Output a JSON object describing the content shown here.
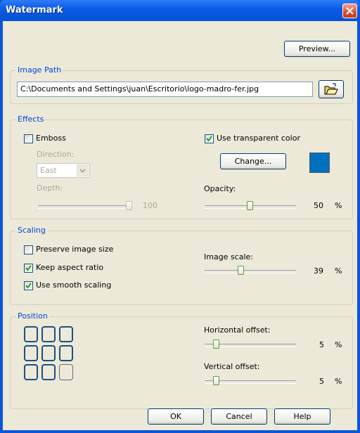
{
  "window": {
    "title": "Watermark"
  },
  "preview_button": "Preview...",
  "image_path": {
    "group_label": "Image Path",
    "path_value": "C:\\Documents and Settings\\juan\\Escritorio\\logo-madro-fer.jpg"
  },
  "effects": {
    "group_label": "Effects",
    "emboss_label": "Emboss",
    "direction_label": "Direction:",
    "direction_value": "East",
    "depth_label": "Depth:",
    "depth_value": "100",
    "use_transparent_label": "Use transparent color",
    "change_button": "Change...",
    "transparent_color": "#0070c0",
    "opacity_label": "Opacity:",
    "opacity_value": "50",
    "opacity_unit": "%"
  },
  "scaling": {
    "group_label": "Scaling",
    "preserve_label": "Preserve image size",
    "keep_aspect_label": "Keep aspect ratio",
    "smooth_label": "Use smooth scaling",
    "image_scale_label": "Image scale:",
    "image_scale_value": "39",
    "image_scale_unit": "%"
  },
  "position": {
    "group_label": "Position",
    "selected_cell": "bottom-right",
    "horizontal_label": "Horizontal offset:",
    "horizontal_value": "5",
    "horizontal_unit": "%",
    "vertical_label": "Vertical offset:",
    "vertical_value": "5",
    "vertical_unit": "%"
  },
  "buttons": {
    "ok": "OK",
    "cancel": "Cancel",
    "help": "Help"
  },
  "colors": {
    "title_bar": "#0553d4",
    "close_button": "#d9502f",
    "group_label": "#0046d5",
    "dialog_bg": "#ece9d8"
  }
}
